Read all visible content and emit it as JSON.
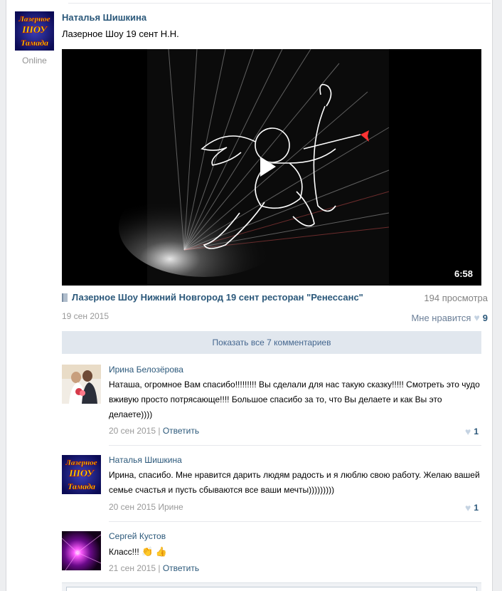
{
  "post": {
    "author": "Наталья Шишкина",
    "status": "Online",
    "text": "Лазерное Шоу 19 сент Н.Н.",
    "avatar_text": [
      "Лазерное",
      "ШОУ",
      "Тамада"
    ],
    "video": {
      "duration": "6:58",
      "title": "Лазерное Шоу Нижний Новгород 19 сент ресторан \"Ренессанс\"",
      "views": "194 просмотра"
    },
    "date": "19 сен 2015",
    "like_label": "Мне нравится",
    "like_count": "9",
    "show_all_comments": "Показать все 7 комментариев"
  },
  "comments": [
    {
      "name": "Ирина Белозёрова",
      "text": "Наташа, огромное Вам спасибо!!!!!!!!! Вы сделали для нас такую сказку!!!!! Смотреть это чудо вживую просто потрясающе!!!! Большое спасибо за то, что Вы делаете и как Вы это делаете))))",
      "date": "20 сен 2015",
      "separator": "|",
      "action": "Ответить",
      "likes": "1"
    },
    {
      "name": "Наталья Шишкина",
      "text": "Ирина, спасибо. Мне нравится дарить людям радость и я люблю свою работу. Желаю вашей семье счастья и пусть сбываются все ваши мечты)))))))))",
      "date": "20 сен 2015",
      "reply_to": "Ирине",
      "likes": "1",
      "avatar_text": [
        "Лазерное",
        "ШОУ",
        "Тамада"
      ]
    },
    {
      "name": "Сергей Кустов",
      "text": "Класс!!!",
      "emojis": [
        "👏",
        "👍"
      ],
      "date": "21 сен 2015",
      "separator": "|",
      "action": "Ответить"
    }
  ],
  "colors": {
    "link": "#2b587a",
    "muted": "#999999",
    "show_all_bg": "#e1e7ee",
    "heart": "#c5d3e2"
  }
}
